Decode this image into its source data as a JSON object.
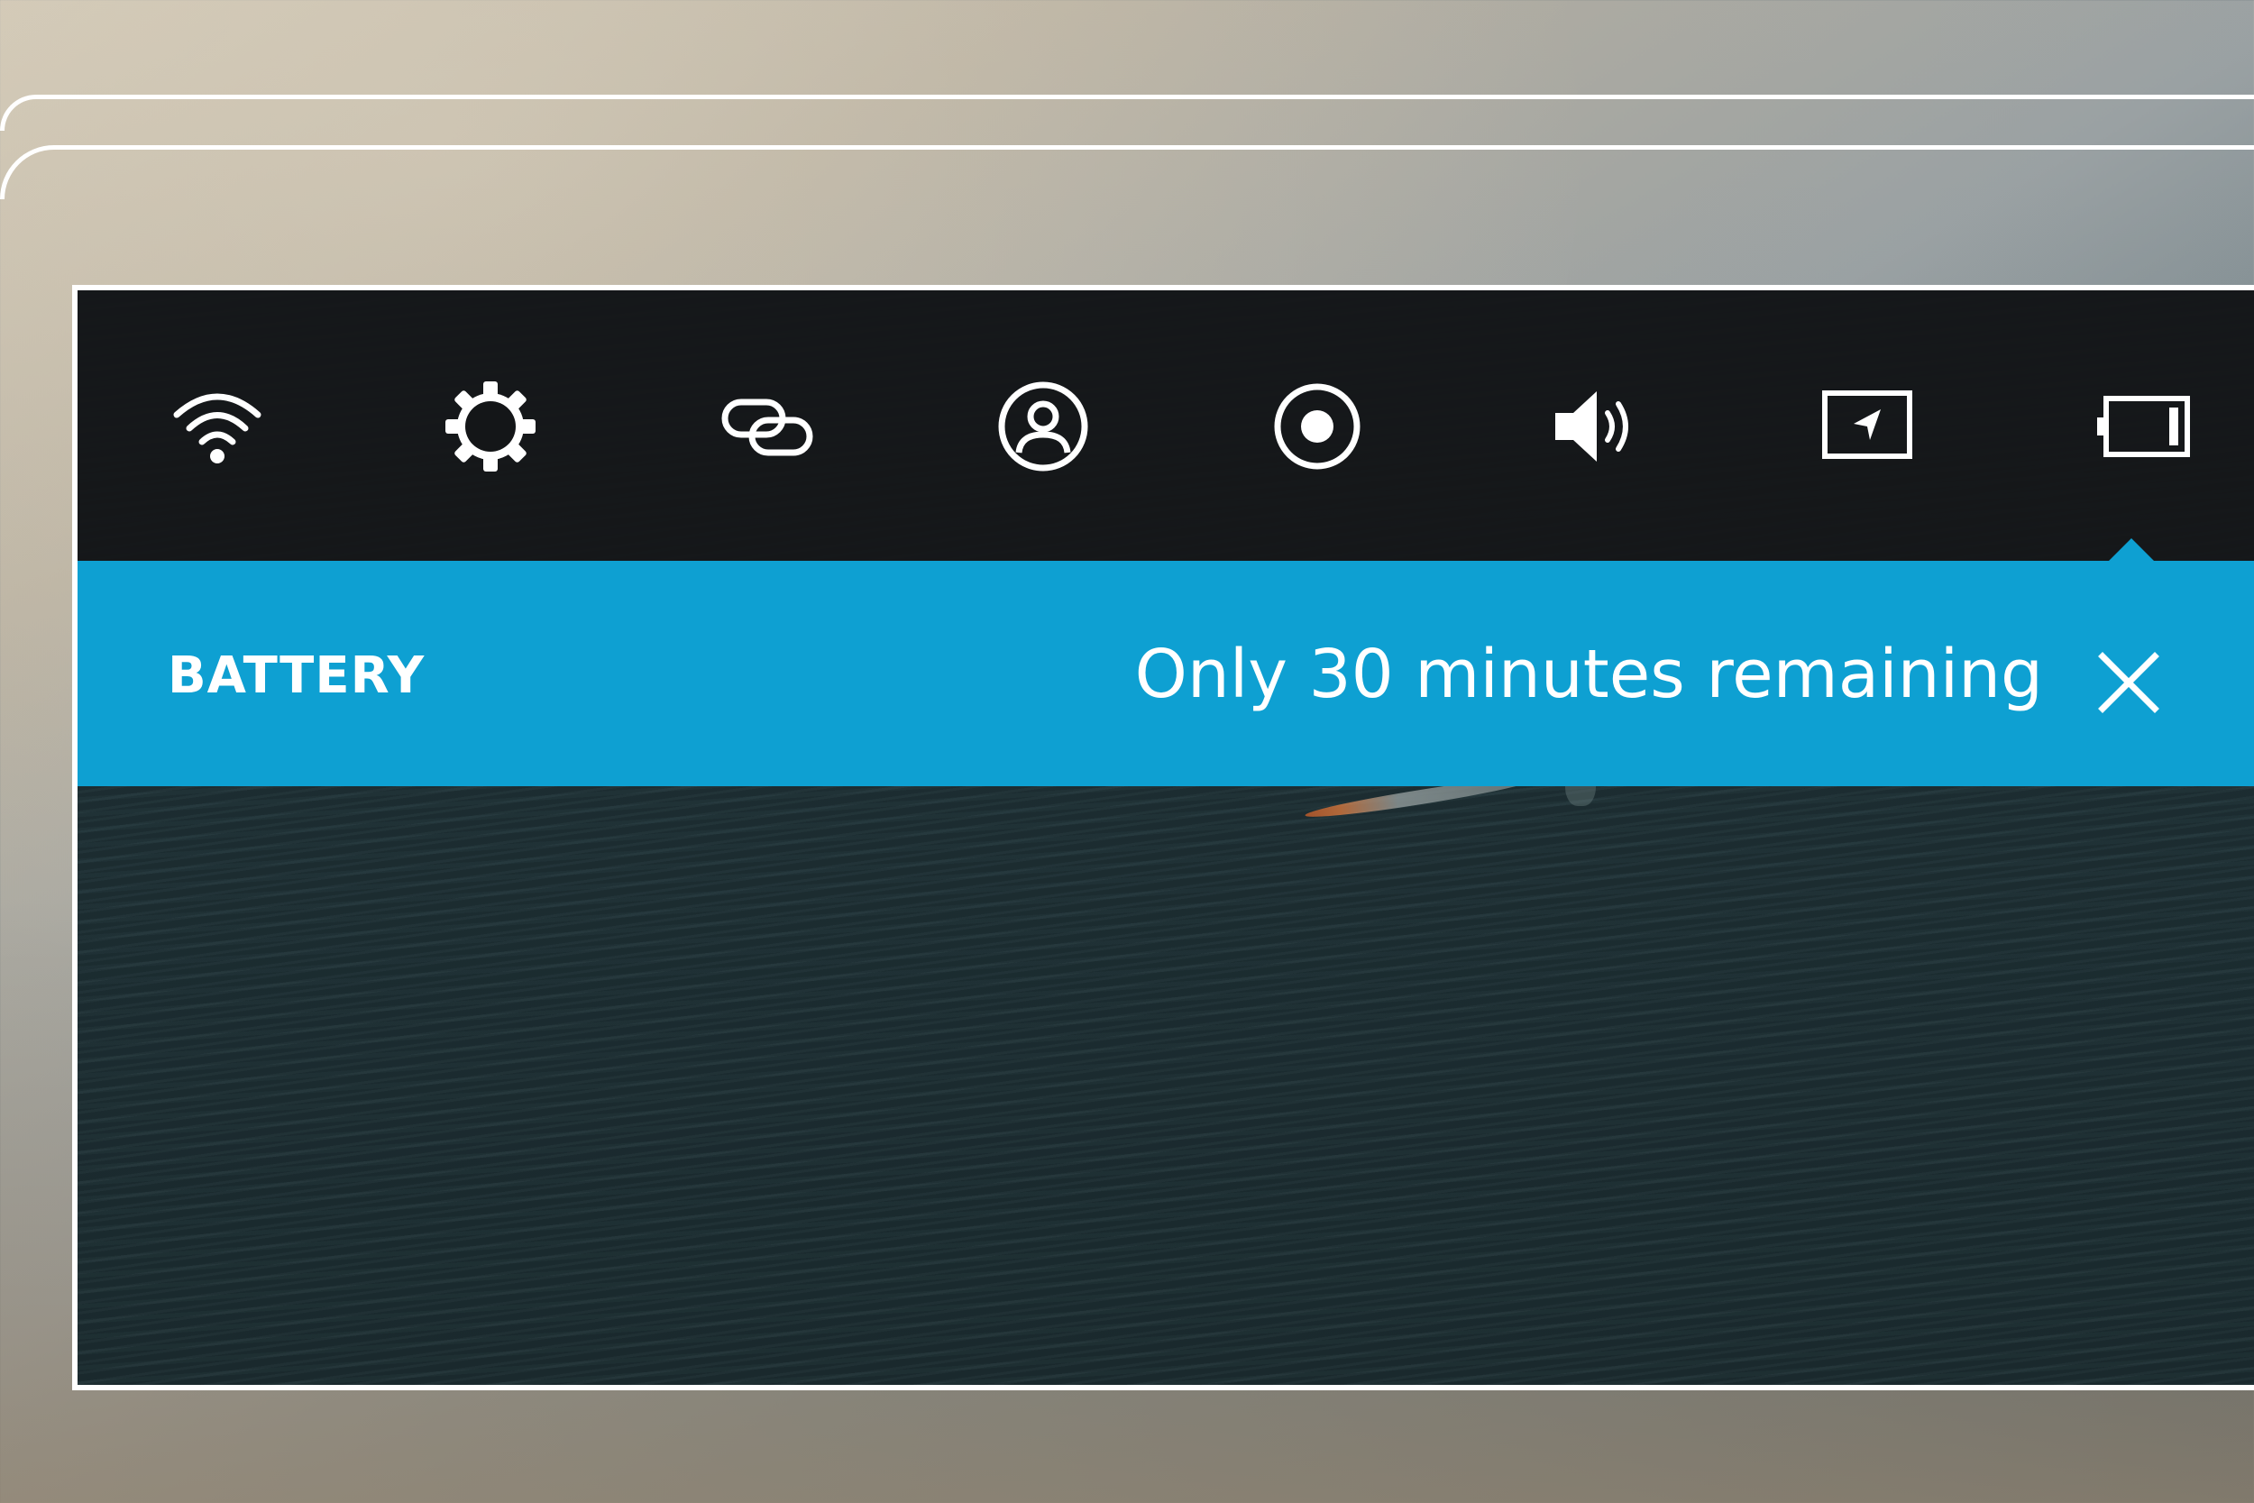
{
  "status_bar": {
    "icons": [
      {
        "name": "wifi-icon"
      },
      {
        "name": "gear-icon"
      },
      {
        "name": "link-icon"
      },
      {
        "name": "account-icon"
      },
      {
        "name": "record-icon"
      },
      {
        "name": "volume-icon"
      },
      {
        "name": "location-icon"
      },
      {
        "name": "battery-icon"
      }
    ]
  },
  "notification": {
    "title": "BATTERY",
    "message": "Only 30 minutes remaining",
    "close_icon": "close-icon",
    "background_color": "#0ea0d2"
  }
}
